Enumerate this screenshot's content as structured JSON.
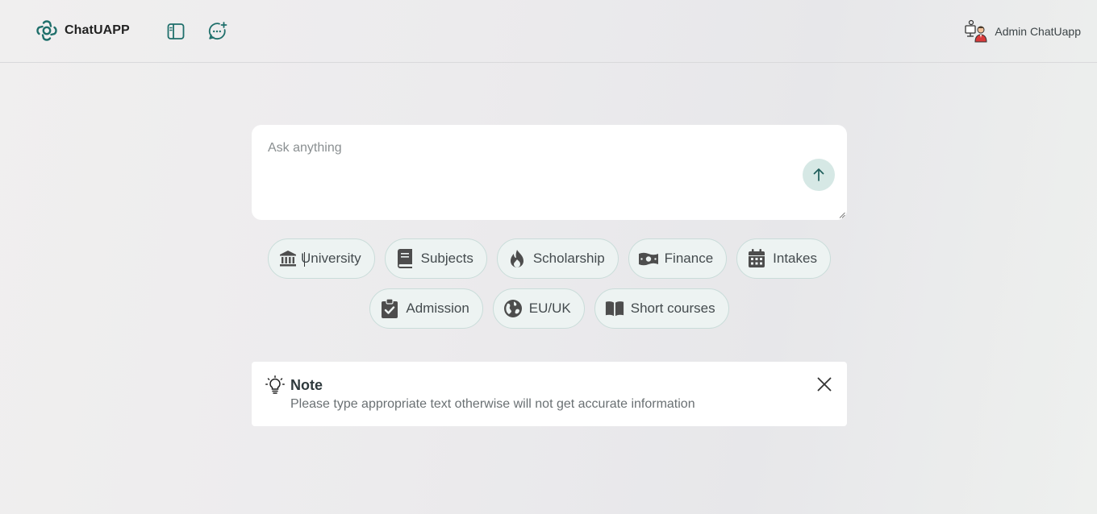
{
  "app": {
    "name": "ChatUAPP",
    "accent_color": "#1f6f6b"
  },
  "header": {
    "icons": [
      "chat-logo-icon",
      "sidebar-toggle-icon",
      "new-chat-icon"
    ],
    "user": {
      "name": "Admin ChatUapp",
      "avatar_icon": "admin-avatar-icon"
    }
  },
  "composer": {
    "placeholder": "Ask anything",
    "value": "",
    "send_icon": "arrow-up-icon"
  },
  "chips": [
    {
      "label": "University",
      "icon": "university-icon"
    },
    {
      "label": "Subjects",
      "icon": "book-icon"
    },
    {
      "label": "Scholarship",
      "icon": "flame-icon"
    },
    {
      "label": "Finance",
      "icon": "money-icon"
    },
    {
      "label": "Intakes",
      "icon": "calendar-icon"
    },
    {
      "label": "Admission",
      "icon": "clipboard-check-icon"
    },
    {
      "label": "EU/UK",
      "icon": "globe-icon"
    },
    {
      "label": "Short courses",
      "icon": "open-book-icon"
    }
  ],
  "note": {
    "title": "Note",
    "text": "Please type appropriate text otherwise will not get accurate information",
    "icon": "lightbulb-icon",
    "close_icon": "close-icon"
  }
}
